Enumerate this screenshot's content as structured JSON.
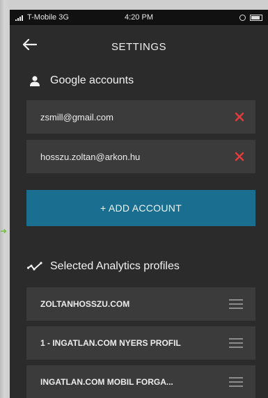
{
  "status_bar": {
    "carrier": "T-Mobile 3G",
    "time": "4:20 PM"
  },
  "header": {
    "title": "SETTINGS"
  },
  "accounts": {
    "heading": "Google accounts",
    "items": [
      {
        "email": "zsmill@gmail.com"
      },
      {
        "email": "hosszu.zoltan@arkon.hu"
      }
    ],
    "add_label": "+ ADD ACCOUNT"
  },
  "profiles": {
    "heading": "Selected Analytics profiles",
    "items": [
      {
        "name": "ZOLTANHOSSZU.COM"
      },
      {
        "name": "1 - INGATLAN.COM NYERS PROFIL"
      },
      {
        "name": "INGATLAN.COM MOBIL FORGA..."
      }
    ]
  },
  "colors": {
    "background": "#2b2b2b",
    "row": "#3b3b3b",
    "accent": "#1a6e8f",
    "remove": "#e03c3c"
  },
  "icons": [
    "back-arrow-icon",
    "person-icon",
    "close-icon",
    "analytics-icon",
    "drag-handle-icon"
  ]
}
